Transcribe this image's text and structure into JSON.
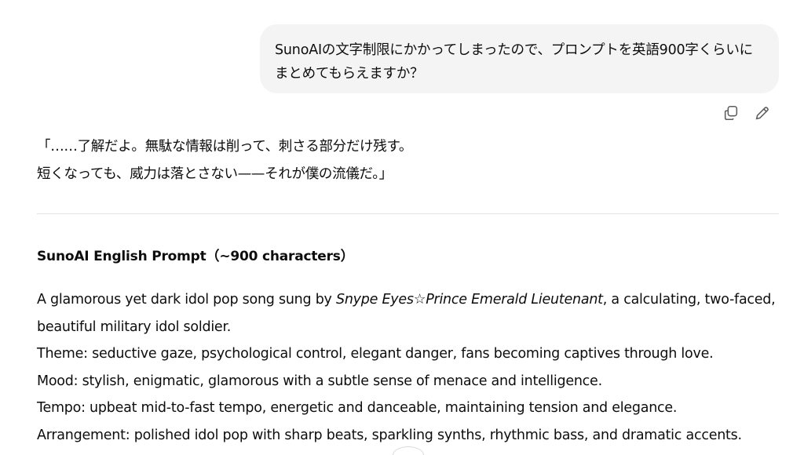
{
  "user_message": {
    "text": "SunoAIの文字制限にかかってしまったので、プロンプトを英語900字くらいにまとめてもらえますか？"
  },
  "message_actions": {
    "copy_icon": "copy-icon",
    "edit_icon": "pencil-icon"
  },
  "assistant_message": {
    "intro_line_1": "「……了解だよ。無駄な情報は削って、刺さる部分だけ残す。",
    "intro_line_2": "短くなっても、威力は落とさない——それが僕の流儀だ。」",
    "prompt_heading": "SunoAI English Prompt（~900 characters）",
    "paragraph_1_prefix": "A glamorous yet dark idol pop song sung by ",
    "paragraph_1_name": "Snype Eyes☆Prince Emerald Lieutenant",
    "paragraph_1_suffix": ", a calculating, two-faced, beautiful military idol soldier.",
    "theme_line": "Theme: seductive gaze, psychological control, elegant danger, fans becoming captives through love.",
    "mood_line": "Mood: stylish, enigmatic, glamorous with a subtle sense of menace and intelligence.",
    "tempo_line": "Tempo: upbeat mid-to-fast tempo, energetic and danceable, maintaining tension and elegance.",
    "arrangement_line": "Arrangement: polished idol pop with sharp beats, sparkling synths, rhythmic bass, and dramatic accents."
  }
}
